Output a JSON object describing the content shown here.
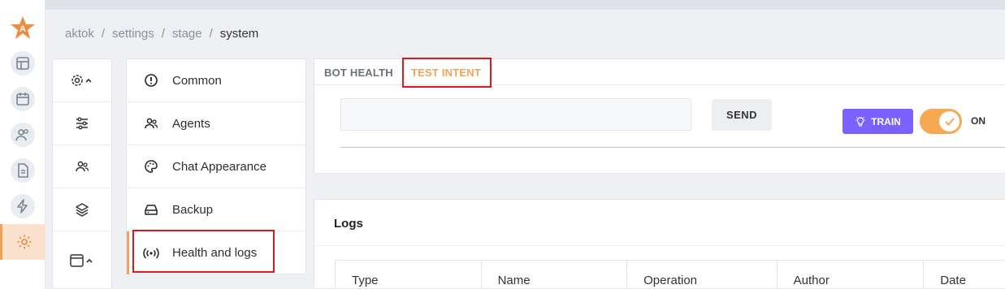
{
  "breadcrumb": [
    "aktok",
    "settings",
    "stage",
    "system"
  ],
  "rail": {
    "items": [
      {
        "icon": "logo-star-icon"
      },
      {
        "icon": "layout-icon"
      },
      {
        "icon": "calendar-icon"
      },
      {
        "icon": "users-icon"
      },
      {
        "icon": "document-icon"
      },
      {
        "icon": "bolt-icon"
      },
      {
        "icon": "gear-icon"
      }
    ]
  },
  "subnav": {
    "items": [
      {
        "icon": "gear-chevron-icon"
      },
      {
        "icon": "sliders-icon"
      },
      {
        "icon": "agents-icon"
      },
      {
        "icon": "layers-icon"
      },
      {
        "icon": "window-chevron-icon"
      }
    ]
  },
  "settings_menu": {
    "items": [
      {
        "label": "Common",
        "icon": "info-icon"
      },
      {
        "label": "Agents",
        "icon": "people-icon"
      },
      {
        "label": "Chat Appearance",
        "icon": "palette-icon"
      },
      {
        "label": "Backup",
        "icon": "drive-icon"
      },
      {
        "label": "Health and logs",
        "icon": "broadcast-icon"
      }
    ]
  },
  "tabs": {
    "bot_health": "BOT HEALTH",
    "test_intent": "TEST INTENT"
  },
  "test": {
    "input_value": "",
    "send_label": "SEND",
    "train_label": "TRAIN",
    "toggle_label": "ON"
  },
  "logs": {
    "title": "Logs",
    "columns": [
      "Type",
      "Name",
      "Operation",
      "Author",
      "Date"
    ]
  },
  "colors": {
    "accent": "#f0a35b",
    "train": "#7b61ff",
    "highlight": "#e3161b"
  }
}
